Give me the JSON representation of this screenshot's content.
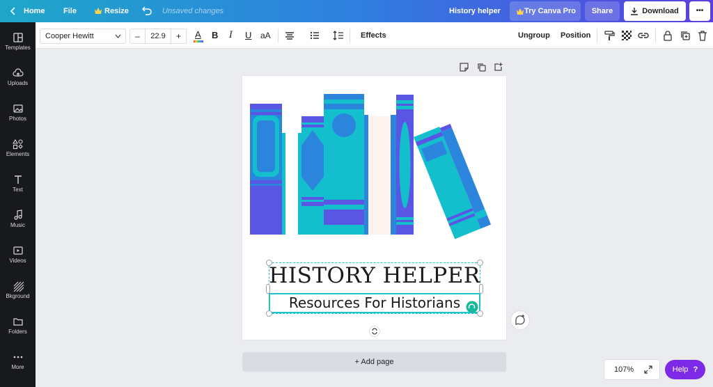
{
  "topbar": {
    "home": "Home",
    "file": "File",
    "resize": "Resize",
    "status": "Unsaved changes",
    "design_title": "History helper",
    "try_pro": "Try Canva Pro",
    "share": "Share",
    "download": "Download",
    "more": "•••"
  },
  "sidebar": {
    "items": [
      {
        "label": "Templates",
        "icon": "templates-icon"
      },
      {
        "label": "Uploads",
        "icon": "uploads-icon"
      },
      {
        "label": "Photos",
        "icon": "photos-icon"
      },
      {
        "label": "Elements",
        "icon": "elements-icon"
      },
      {
        "label": "Text",
        "icon": "text-icon"
      },
      {
        "label": "Music",
        "icon": "music-icon"
      },
      {
        "label": "Videos",
        "icon": "videos-icon"
      },
      {
        "label": "Bkground",
        "icon": "background-icon"
      },
      {
        "label": "Folders",
        "icon": "folders-icon"
      },
      {
        "label": "More",
        "icon": "more-icon"
      }
    ]
  },
  "toolbar": {
    "font": "Cooper Hewitt",
    "font_size": "22.9",
    "minus": "–",
    "plus": "+",
    "color_glyph": "A",
    "bold": "B",
    "italic": "I",
    "underline": "U",
    "case": "aA",
    "effects": "Effects",
    "ungroup": "Ungroup",
    "position": "Position"
  },
  "canvas": {
    "title": "HISTORY HELPER",
    "subtitle": "Resources For Historians",
    "add_page": "+ Add page"
  },
  "footer": {
    "zoom": "107%",
    "help": "Help",
    "help_glyph": "?"
  },
  "colors": {
    "teal": "#14bfcd",
    "blue": "#2b85dc",
    "purple": "#5b55e4",
    "pink": "#fff3f1",
    "selection": "#1fc4c8",
    "help": "#7d2ae8"
  }
}
